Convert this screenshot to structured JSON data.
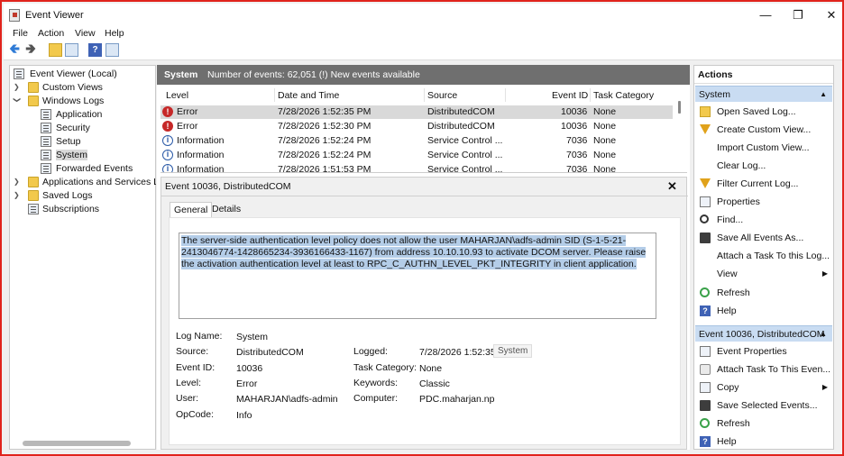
{
  "window": {
    "title": "Event Viewer"
  },
  "menu": [
    "File",
    "Action",
    "View",
    "Help"
  ],
  "tree": {
    "root": "Event Viewer (Local)",
    "custom_views": "Custom Views",
    "windows_logs": "Windows Logs",
    "application": "Application",
    "security": "Security",
    "setup": "Setup",
    "system": "System",
    "forwarded": "Forwarded Events",
    "apps_services": "Applications and Services Log",
    "saved_logs": "Saved Logs",
    "subscriptions": "Subscriptions"
  },
  "center": {
    "title": "System",
    "count": "Number of events: 62,051 (!) New events available",
    "columns": [
      "Level",
      "Date and Time",
      "Source",
      "Event ID",
      "Task Category"
    ],
    "rows": [
      {
        "level": "Error",
        "datetime": "7/28/2026 1:52:35 PM",
        "source": "DistributedCOM",
        "event_id": "10036",
        "task": "None",
        "icon": "error-icon"
      },
      {
        "level": "Error",
        "datetime": "7/28/2026 1:52:30 PM",
        "source": "DistributedCOM",
        "event_id": "10036",
        "task": "None",
        "icon": "error-icon"
      },
      {
        "level": "Information",
        "datetime": "7/28/2026 1:52:24 PM",
        "source": "Service Control ...",
        "event_id": "7036",
        "task": "None",
        "icon": "info-icon"
      },
      {
        "level": "Information",
        "datetime": "7/28/2026 1:52:24 PM",
        "source": "Service Control ...",
        "event_id": "7036",
        "task": "None",
        "icon": "info-icon"
      },
      {
        "level": "Information",
        "datetime": "7/28/2026 1:51:53 PM",
        "source": "Service Control ...",
        "event_id": "7036",
        "task": "None",
        "icon": "info-icon"
      }
    ]
  },
  "detail": {
    "title": "Event 10036, DistributedCOM",
    "tabs": [
      "General",
      "Details"
    ],
    "message": "The server-side authentication level policy does not allow the user MAHARJAN\\adfs-admin SID (S-1-5-21-2413046774-1428665234-3936166433-1167) from address 10.10.10.93 to activate DCOM server. Please raise the activation authentication level at least to RPC_C_AUTHN_LEVEL_PKT_INTEGRITY in client application.",
    "fields": {
      "log_name_label": "Log Name:",
      "log_name": "System",
      "source_label": "Source:",
      "source": "DistributedCOM",
      "logged_label": "Logged:",
      "logged": "7/28/2026 1:52:35 PI",
      "event_id_label": "Event ID:",
      "event_id": "10036",
      "task_label": "Task Category:",
      "task": "None",
      "level_label": "Level:",
      "level": "Error",
      "keywords_label": "Keywords:",
      "keywords": "Classic",
      "user_label": "User:",
      "user": "MAHARJAN\\adfs-admin",
      "computer_label": "Computer:",
      "computer": "PDC.maharjan.np",
      "opcode_label": "OpCode:",
      "opcode": "Info"
    },
    "tooltip": "System"
  },
  "actions": {
    "header": "Actions",
    "section1": "System",
    "items1": [
      "Open Saved Log...",
      "Create Custom View...",
      "Import Custom View...",
      "Clear Log...",
      "Filter Current Log...",
      "Properties",
      "Find...",
      "Save All Events As...",
      "Attach a Task To this Log...",
      "View",
      "Refresh",
      "Help"
    ],
    "section2": "Event 10036, DistributedCOM",
    "items2": [
      "Event Properties",
      "Attach Task To This Even...",
      "Copy",
      "Save Selected Events...",
      "Refresh",
      "Help"
    ]
  },
  "colors": {
    "frame": "#e0231c",
    "header": "#6f6f6f",
    "section": "#c9dcf2",
    "selection": "#b4cde8"
  }
}
